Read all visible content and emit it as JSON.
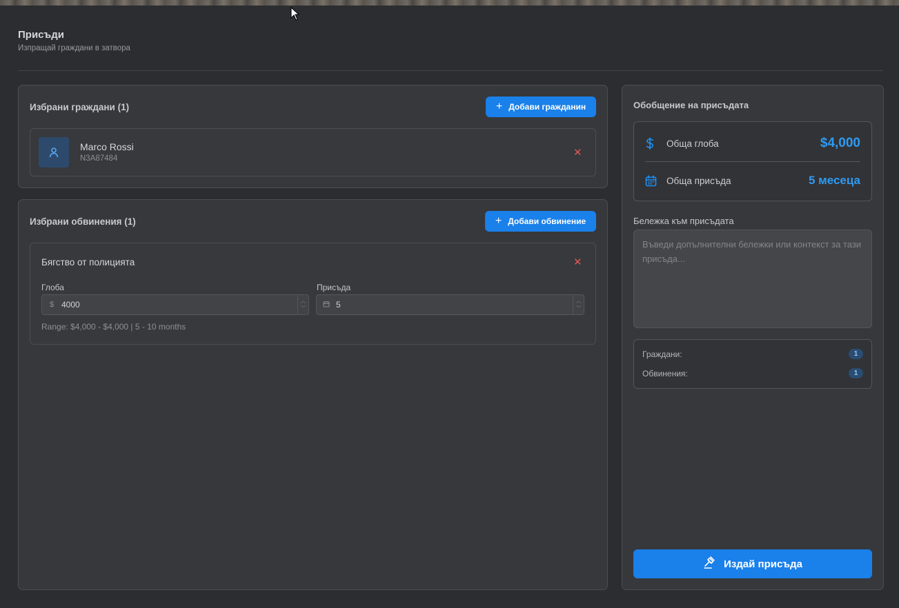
{
  "page": {
    "title": "Присъди",
    "subtitle": "Изпращай граждани в затвора"
  },
  "citizens": {
    "title": "Избрани граждани (1)",
    "add_button": "Добави гражданин",
    "items": [
      {
        "name": "Marco Rossi",
        "id": "N3A87484"
      }
    ]
  },
  "charges": {
    "title": "Избрани обвинения (1)",
    "add_button": "Добави обвинение",
    "items": [
      {
        "name": "Бягство от полицията",
        "fine_label": "Глоба",
        "fine_prefix": "$",
        "fine_value": "4000",
        "sentence_label": "Присъда",
        "sentence_value": "5",
        "range": "Range: $4,000 - $4,000 | 5 - 10 months"
      }
    ]
  },
  "summary": {
    "title": "Обобщение на присъдата",
    "total_fine_label": "Обща глоба",
    "total_fine_value": "$4,000",
    "total_sentence_label": "Обща присъда",
    "total_sentence_value": "5 месеца",
    "note_label": "Бележка към присъдата",
    "note_placeholder": "Въведи допълнителни бележки или контекст за тази присъда...",
    "citizens_count_label": "Граждани:",
    "citizens_count": "1",
    "charges_count_label": "Обвинения:",
    "charges_count": "1",
    "issue_button": "Издай присъда"
  },
  "icons": {
    "add": "plus-icon",
    "remove": "close-icon",
    "citizen": "user-icon",
    "fine": "dollar-icon",
    "sentence": "calendar-icon",
    "issue": "gavel-icon"
  },
  "colors": {
    "accent": "#1a80ea",
    "amount": "#2d9bf5",
    "danger": "#e25757",
    "panel": "#37383b",
    "background": "#2c2d30"
  }
}
